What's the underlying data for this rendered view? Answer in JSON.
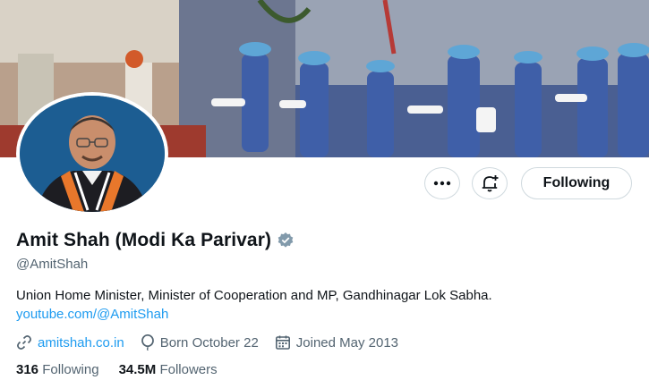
{
  "profile": {
    "name": "Amit Shah (Modi Ka Parivar)",
    "handle": "@AmitShah",
    "bio": "Union Home Minister, Minister of Cooperation and MP, Gandhinagar Lok Sabha.",
    "bio_link": "youtube.com/@AmitShah",
    "website": "amitshah.co.in",
    "born": "Born October 22",
    "joined": "Joined May 2013",
    "following_count": "316",
    "following_label": "Following",
    "followers_count": "34.5M",
    "followers_label": "Followers",
    "verified_color": "#829aab"
  },
  "actions": {
    "more_icon": "more-icon",
    "notify_icon": "bell-plus-icon",
    "following_button": "Following"
  },
  "colors": {
    "link": "#1d9bf0",
    "secondary_text": "#536471",
    "border": "#cfd9de"
  }
}
